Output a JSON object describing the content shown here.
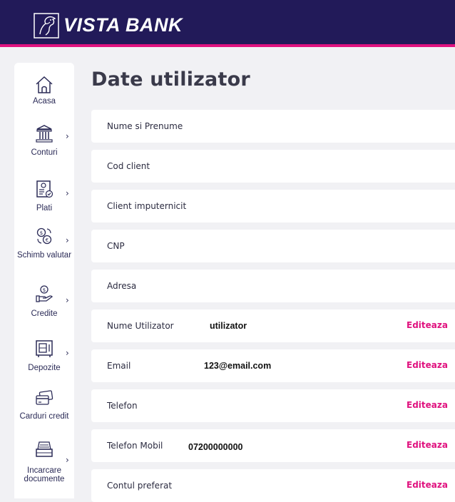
{
  "header": {
    "brand": "VISTA BANK",
    "logo_icon": "horse-logo-icon",
    "background": "#221a59",
    "accent": "#e0127f"
  },
  "sidebar": {
    "items": [
      {
        "label": "Acasa",
        "icon": "home-icon",
        "has_submenu": false
      },
      {
        "label": "Conturi",
        "icon": "bank-building-icon",
        "has_submenu": true
      },
      {
        "label": "Plati",
        "icon": "payment-document-icon",
        "has_submenu": true
      },
      {
        "label": "Schimb valutar",
        "icon": "currency-exchange-icon",
        "has_submenu": true
      },
      {
        "label": "Credite",
        "icon": "hand-coin-icon",
        "has_submenu": true
      },
      {
        "label": "Depozite",
        "icon": "safe-icon",
        "has_submenu": true
      },
      {
        "label": "Carduri credit",
        "icon": "credit-card-icon",
        "has_submenu": false
      },
      {
        "label": "Incarcare documente",
        "icon": "document-upload-icon",
        "has_submenu": true
      }
    ],
    "chevron": "›"
  },
  "main": {
    "title": "Date utilizator",
    "edit_label": "Editeaza",
    "rows": [
      {
        "label": "Nume si Prenume",
        "value": "",
        "editable": false
      },
      {
        "label": "Cod client",
        "value": "",
        "editable": false
      },
      {
        "label": "Client imputernicit",
        "value": "",
        "editable": false
      },
      {
        "label": "CNP",
        "value": "",
        "editable": false
      },
      {
        "label": "Adresa",
        "value": "",
        "editable": false
      },
      {
        "label": "Nume Utilizator",
        "value": "utilizator",
        "editable": true
      },
      {
        "label": "Email",
        "value": "123@email.com",
        "editable": true
      },
      {
        "label": "Telefon",
        "value": "",
        "editable": true
      },
      {
        "label": "Telefon Mobil",
        "value": "07200000000",
        "editable": true
      },
      {
        "label": "Contul preferat",
        "value": "",
        "editable": true
      }
    ]
  }
}
